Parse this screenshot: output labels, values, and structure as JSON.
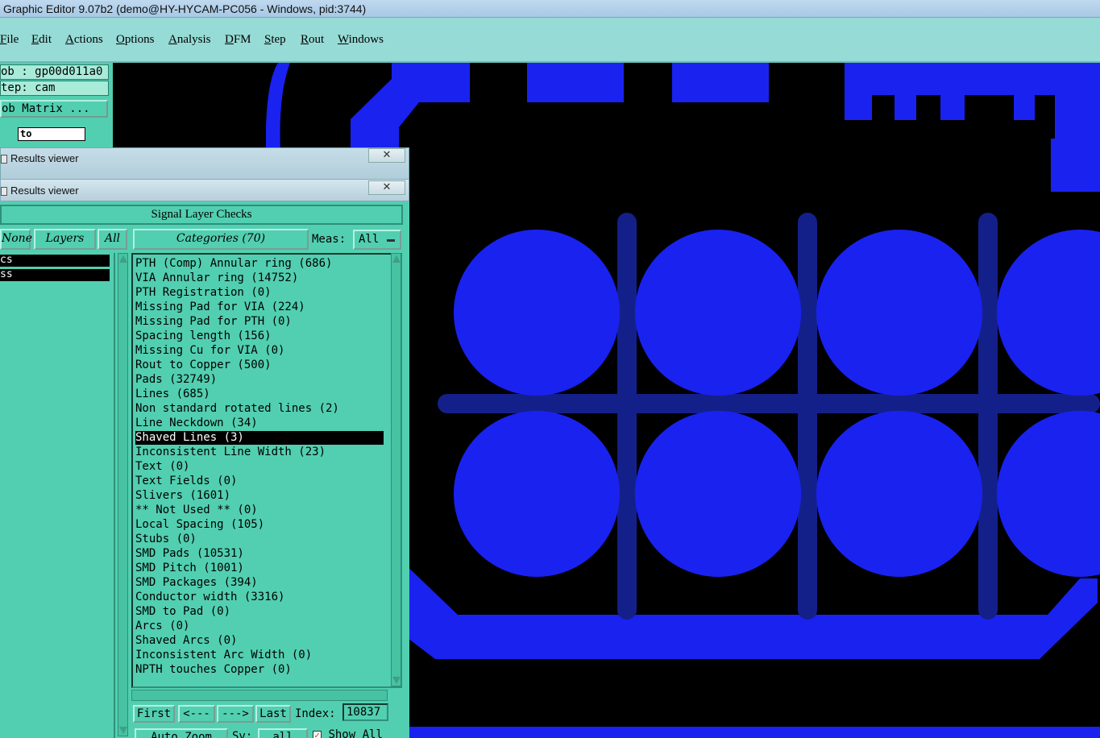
{
  "window": {
    "title": "Graphic Editor 9.07b2 (demo@HY-HYCAM-PC056 - Windows, pid:3744)"
  },
  "menu": [
    "File",
    "Edit",
    "Actions",
    "Options",
    "Analysis",
    "DFM",
    "Step",
    "Rout",
    "Windows"
  ],
  "left_panel": {
    "job": "ob : gp00d011a0",
    "step": "tep: cam",
    "job_matrix": "ob Matrix ...",
    "to_field": "to"
  },
  "results_viewer": {
    "title_back": "Results viewer",
    "title_front": "Results viewer",
    "close_glyph": "✕",
    "header": "Signal Layer Checks",
    "none_btn": "None",
    "layers_btn": "Layers",
    "all_btn": "All",
    "categories_btn": "Categories (70)",
    "meas_label": "Meas:",
    "meas_value": "All",
    "layers": [
      "cs",
      "ss"
    ],
    "categories": [
      "PTH (Comp) Annular ring (686)",
      "VIA Annular ring (14752)",
      "PTH Registration (0)",
      "Missing Pad for VIA (224)",
      "Missing Pad for PTH (0)",
      "Spacing length (156)",
      "Missing Cu for VIA (0)",
      "Rout to Copper (500)",
      "Pads (32749)",
      "Lines (685)",
      "Non standard rotated lines (2)",
      "Line Neckdown (34)",
      "Shaved Lines (3)",
      "Inconsistent Line Width (23)",
      "Text (0)",
      "Text Fields (0)",
      "Slivers (1601)",
      "** Not Used ** (0)",
      "Local Spacing (105)",
      "Stubs (0)",
      "SMD Pads (10531)",
      "SMD Pitch (1001)",
      "SMD Packages (394)",
      "Conductor width (3316)",
      "SMD to Pad (0)",
      "Arcs (0)",
      "Shaved Arcs (0)",
      "Inconsistent Arc Width (0)",
      "NPTH touches Copper (0)"
    ],
    "selected_category": "Shaved Lines (3)",
    "nav": {
      "first": "First",
      "prev": "<---",
      "next": "--->",
      "last": "Last",
      "index_label": "Index:",
      "index_value": "10837"
    },
    "auto_zoom": "Auto Zoom",
    "sv_label": "Sv:",
    "sv_value": "all",
    "show_all": "Show All"
  },
  "colors": {
    "copper": "#1a22f0",
    "trace_dark": "#14208a",
    "panel": "#52cfb0",
    "menubar": "#96dbd6",
    "canvas_bg": "#000000"
  }
}
